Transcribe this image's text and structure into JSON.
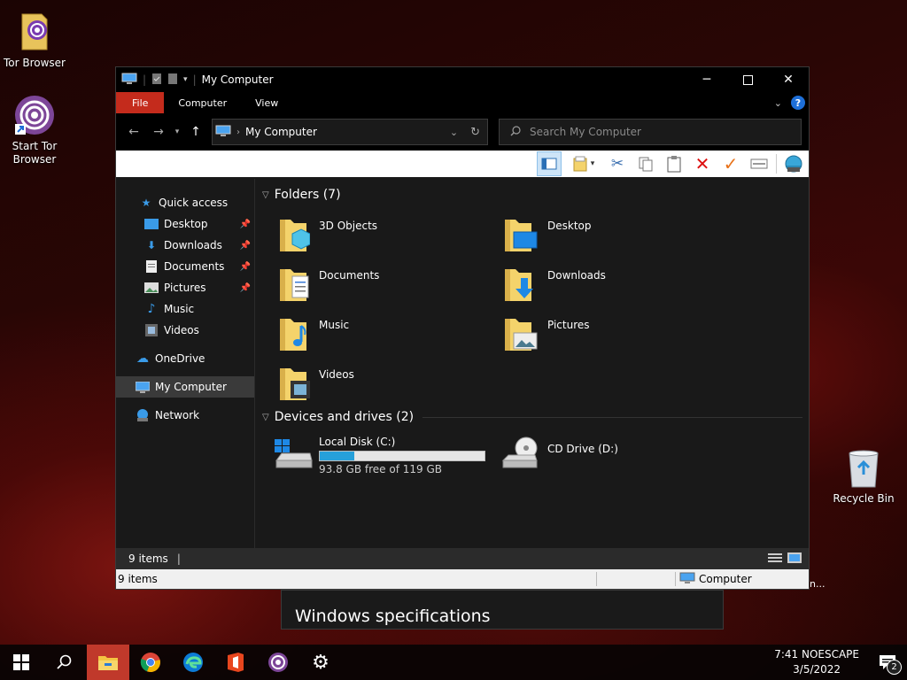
{
  "desktop": {
    "icons": [
      {
        "label": "Tor Browser"
      },
      {
        "label": "Start Tor Browser"
      },
      {
        "label": "Recycle Bin"
      }
    ]
  },
  "window": {
    "title": "My Computer",
    "ribbon_tabs": [
      "File",
      "Computer",
      "View"
    ],
    "address": "My Computer",
    "search_placeholder": "Search My Computer",
    "nav": {
      "quick_access": "Quick access",
      "items": [
        {
          "label": "Desktop",
          "pinned": true
        },
        {
          "label": "Downloads",
          "pinned": true
        },
        {
          "label": "Documents",
          "pinned": true
        },
        {
          "label": "Pictures",
          "pinned": true
        },
        {
          "label": "Music",
          "pinned": false
        },
        {
          "label": "Videos",
          "pinned": false
        }
      ],
      "onedrive": "OneDrive",
      "this_pc": "My Computer",
      "network": "Network"
    },
    "folders_header": "Folders (7)",
    "folders": [
      "3D Objects",
      "Desktop",
      "Documents",
      "Downloads",
      "Music",
      "Pictures",
      "Videos"
    ],
    "devices_header": "Devices and drives (2)",
    "drives": [
      {
        "name": "Local Disk (C:)",
        "free_text": "93.8 GB free of 119 GB",
        "used_fraction": 0.212
      },
      {
        "name": "CD Drive (D:)"
      }
    ],
    "status": {
      "items": "9 items",
      "items2": "9 items",
      "location": "Computer",
      "overflow": "n..."
    }
  },
  "behind_panel": {
    "title": "Windows specifications"
  },
  "taskbar": {
    "time": "7:41 NOESCAPE",
    "date": "3/5/2022",
    "notification_count": "2"
  },
  "colors": {
    "file_tab": "#c42b1c",
    "accent": "#0078d7"
  }
}
